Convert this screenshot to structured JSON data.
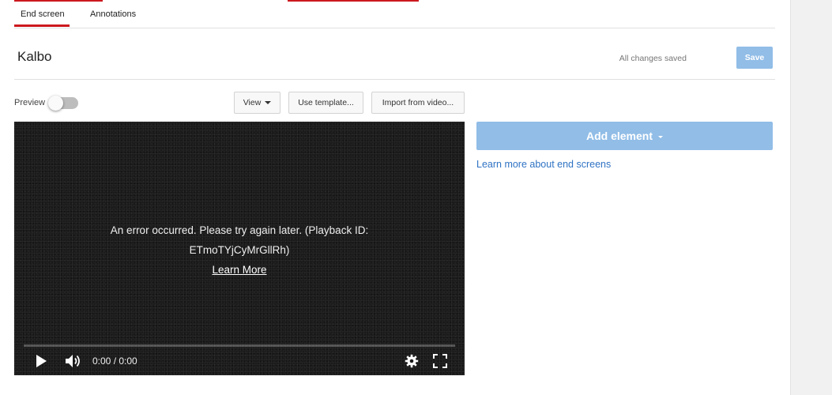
{
  "tabs": [
    {
      "label": "End screen",
      "active": true
    },
    {
      "label": "Annotations",
      "active": false
    }
  ],
  "header": {
    "title": "Kalbo",
    "status": "All changes saved",
    "save_label": "Save"
  },
  "toolbar": {
    "preview_label": "Preview",
    "preview_on": false,
    "view_label": "View",
    "template_label": "Use template...",
    "import_label": "Import from video..."
  },
  "video": {
    "error_line1": "An error occurred. Please try again later. (Playback ID:",
    "error_line2": "ETmoTYjCyMrGllRh)",
    "learn_more": "Learn More",
    "time": "0:00 / 0:00",
    "progress": 0
  },
  "sidebar": {
    "add_element_label": "Add element",
    "learn_link": "Learn more about end screens"
  },
  "colors": {
    "accent_red": "#cc181e",
    "button_blue": "#91bde7",
    "link_blue": "#2f73c4"
  },
  "icons": {
    "play": "play-icon",
    "volume": "volume-icon",
    "settings": "gear-icon",
    "fullscreen": "fullscreen-icon",
    "dropdown": "caret-down-icon"
  }
}
